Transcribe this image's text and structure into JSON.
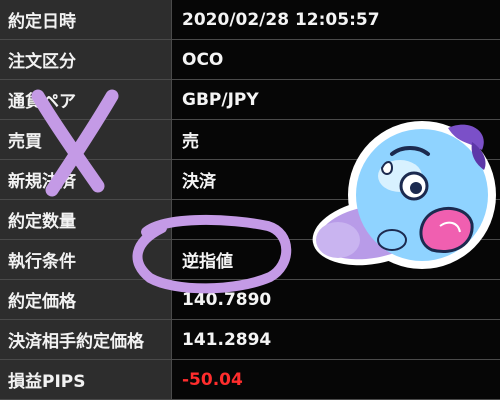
{
  "order_details": {
    "rows": [
      {
        "label": "約定日時",
        "value": "2020/02/28 12:05:57"
      },
      {
        "label": "注文区分",
        "value": "OCO"
      },
      {
        "label": "通貨ペア",
        "value": "GBP/JPY"
      },
      {
        "label": "売買",
        "value": "売"
      },
      {
        "label": "新規決済",
        "value": "決済"
      },
      {
        "label": "約定数量",
        "value": ""
      },
      {
        "label": "執行条件",
        "value": "逆指値"
      },
      {
        "label": "約定価格",
        "value": "140.7890"
      },
      {
        "label": "決済相手約定価格",
        "value": "141.2894"
      },
      {
        "label": "損益PIPS",
        "value": "-50.04"
      }
    ]
  },
  "annotations": {
    "cross_mark_color": "#c49ae6",
    "circle_mark_color": "#c49ae6",
    "sticker": "blue-character-sticker"
  },
  "colors": {
    "loss": "#ff2d2d",
    "label_bg": "#2d2d2d",
    "value_bg": "#060606"
  }
}
